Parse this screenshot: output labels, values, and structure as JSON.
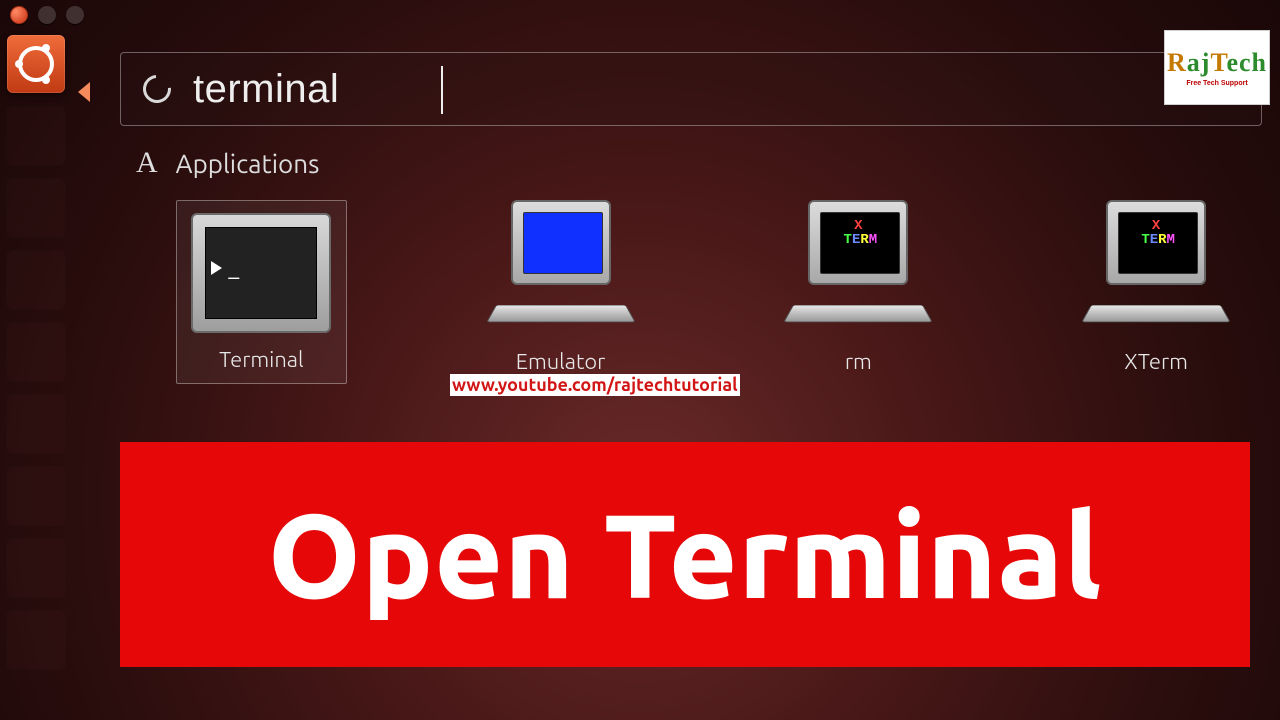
{
  "window_controls": [
    "close",
    "minimize",
    "maximize"
  ],
  "dash": {
    "search_value": "terminal",
    "search_placeholder": "",
    "section_label": "Applications"
  },
  "results": [
    {
      "label": "Terminal",
      "icon": "terminal-icon",
      "selected": true
    },
    {
      "label": "Emulator",
      "icon": "computer-blue-icon",
      "selected": false
    },
    {
      "label": "rm",
      "icon": "xterm-icon",
      "selected": false
    },
    {
      "label": "XTerm",
      "icon": "xterm-icon",
      "selected": false
    }
  ],
  "xterm_glyphs": {
    "l1": "X",
    "l2": [
      "T",
      "E",
      "R",
      "M"
    ]
  },
  "overlay_url": "www.youtube.com/rajtechtutorial",
  "big_title": "Open Terminal",
  "channel_logo": {
    "name": "RajTech",
    "subtitle": "Free Tech Support"
  }
}
